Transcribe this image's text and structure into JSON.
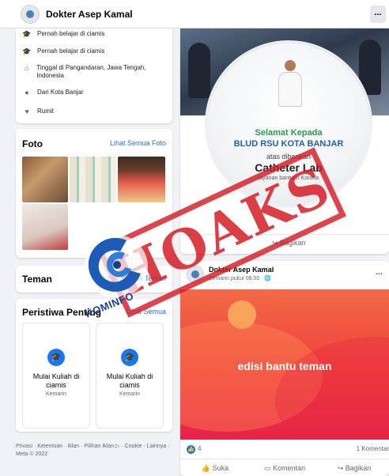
{
  "header": {
    "page_name": "Dokter Asep Kamal",
    "more_label": "..."
  },
  "intro": {
    "items": [
      {
        "icon": "graduation-cap-icon",
        "text": "Pernah belajar di ciamis"
      },
      {
        "icon": "graduation-cap-icon",
        "text": "Pernah belajar di ciamis"
      },
      {
        "icon": "home-icon",
        "text": "Tinggal di Pangandaran, Jawa Tengah, Indonesia"
      },
      {
        "icon": "location-pin-icon",
        "text": "Dari Kota Banjar"
      },
      {
        "icon": "heart-icon",
        "text": "Rumit"
      }
    ]
  },
  "photos": {
    "title": "Foto",
    "see_all": "Lihat Semua Foto"
  },
  "friends": {
    "title": "Teman",
    "see_all": "Lihat Semua Teman"
  },
  "events": {
    "title": "Peristiwa Penting",
    "see_all": "Lihat Semua",
    "items": [
      {
        "text": "Mulai Kuliah di ciamis",
        "time": "Kemarin"
      },
      {
        "text": "Mulai Kuliah di ciamis",
        "time": "Kemarin"
      }
    ]
  },
  "footer": {
    "text": "Privasi · Ketentuan · Iklan · Pilihan Iklan ▷ · Cookie · Lainnya · Meta © 2022"
  },
  "post1": {
    "poster_line1": "Selamat Kepada",
    "poster_line2": "BLUD RSU KOTA BANJAR",
    "poster_line3": "atas diberikan",
    "poster_line4": "Catheter Lab",
    "poster_line5": "layanan bantuan Korona",
    "share_label": "Bagikan"
  },
  "post2": {
    "author": "Dokter Asep Kamal",
    "meta": "Kemarin pukul 08.50 · 🌐",
    "more_label": "...",
    "image_caption": "edisi bantu teman",
    "reactions_count": "4",
    "comments_count": "1 Komentar",
    "like_label": "Suka",
    "comment_label": "Komentari",
    "share_label": "Bagikan"
  },
  "overlay": {
    "stamp_text": "HOAKS",
    "logo_text": "KOMINFO"
  },
  "colors": {
    "accent": "#1877f2",
    "stamp": "#d61c24",
    "link": "#216fdb",
    "banner": "#ef3f3c"
  }
}
